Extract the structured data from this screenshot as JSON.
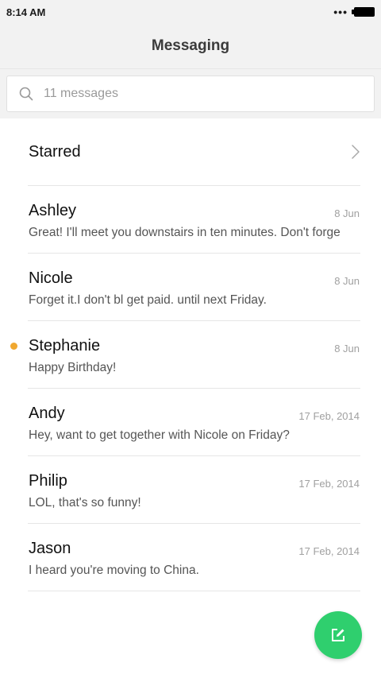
{
  "status_bar": {
    "time": "8:14 AM",
    "signal": "•••"
  },
  "header": {
    "title": "Messaging"
  },
  "search": {
    "placeholder": "11 messages",
    "icon": "search-icon"
  },
  "starred": {
    "label": "Starred",
    "icon": "chevron-right-icon"
  },
  "conversations": [
    {
      "name": "Ashley",
      "date": "8 Jun",
      "preview": "Great! I'll meet you downstairs in ten minutes. Don't forge",
      "unread": false
    },
    {
      "name": "Nicole",
      "date": "8 Jun",
      "preview": "Forget it.I don't bl get paid. until next Friday.",
      "unread": false
    },
    {
      "name": "Stephanie",
      "date": "8 Jun",
      "preview": "Happy Birthday!",
      "unread": true
    },
    {
      "name": "Andy",
      "date": "17 Feb, 2014",
      "preview": "Hey, want to get together with Nicole on Friday?",
      "unread": false
    },
    {
      "name": "Philip",
      "date": "17 Feb, 2014",
      "preview": "LOL, that's so funny!",
      "unread": false
    },
    {
      "name": "Jason",
      "date": "17 Feb, 2014",
      "preview": "I heard you're moving to China.",
      "unread": false
    }
  ],
  "fab": {
    "icon": "compose-icon"
  },
  "colors": {
    "accent_green": "#2fcf6e",
    "unread_dot": "#f0a830",
    "bar_background": "#f2f2f2"
  }
}
